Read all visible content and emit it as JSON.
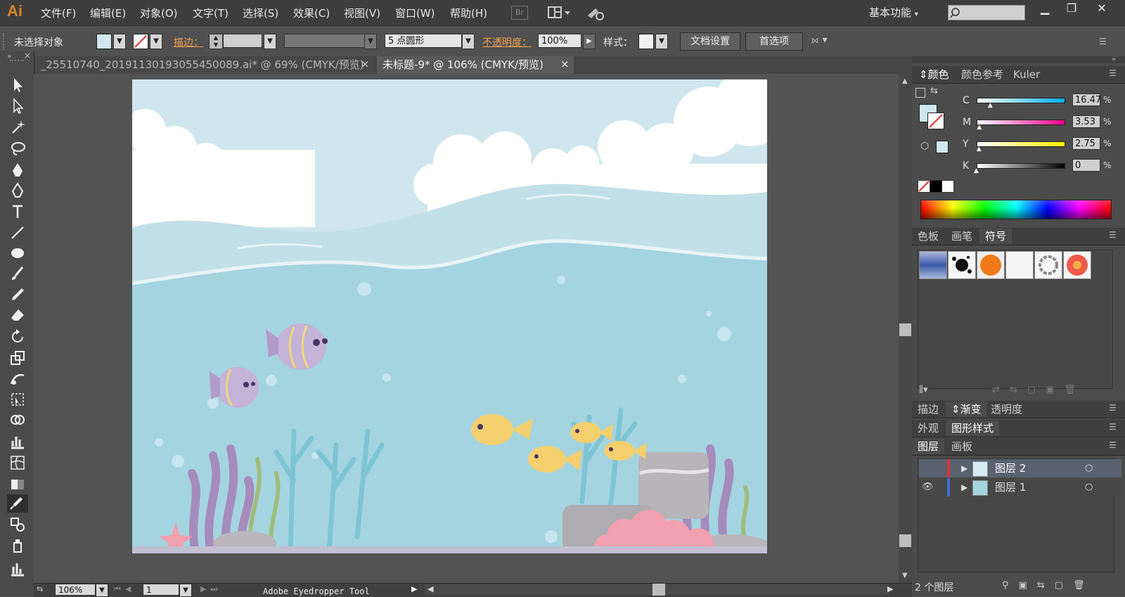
{
  "app": {
    "logo": "Ai"
  },
  "menu": [
    "文件(F)",
    "编辑(E)",
    "对象(O)",
    "文字(T)",
    "选择(S)",
    "效果(C)",
    "视图(V)",
    "窗口(W)",
    "帮助(H)"
  ],
  "toolbar_top": {
    "bridge": "Br",
    "workspace": "基本功能"
  },
  "control": {
    "no_selection": "未选择对象",
    "stroke_label": "描边：",
    "brush": "5 点圆形",
    "opacity_label": "不透明度：",
    "opacity_value": "100%",
    "style_label": "样式：",
    "doc_setup": "文档设置",
    "preferences": "首选项"
  },
  "tabs": [
    {
      "label": "_25510740_20191130193055450089.ai* @ 69% (CMYK/预览)",
      "active": false
    },
    {
      "label": "未标题-9* @ 106% (CMYK/预览)",
      "active": true
    }
  ],
  "tools": [
    "selection-tool",
    "direct-selection-tool",
    "magic-wand-tool",
    "lasso-tool",
    "pen-tool",
    "pen-curvature-tool",
    "type-tool",
    "line-tool",
    "ellipse-tool",
    "paintbrush-tool",
    "pencil-tool",
    "eraser-tool",
    "rotate-tool",
    "scale-tool",
    "warp-tool",
    "free-transform-tool",
    "shape-builder-tool",
    "graph-tool",
    "mesh-tool",
    "gradient-tool",
    "eyedropper-tool",
    "blend-tool",
    "symbol-sprayer-tool",
    "column-graph-tool"
  ],
  "panels": {
    "color_tabs": [
      "颜色",
      "颜色参考",
      "Kuler"
    ],
    "cmyk": [
      {
        "label": "C",
        "value": "16.47",
        "pct": 0.16
      },
      {
        "label": "M",
        "value": "3.53",
        "pct": 0.035
      },
      {
        "label": "Y",
        "value": "2.75",
        "pct": 0.03
      },
      {
        "label": "K",
        "value": "0",
        "pct": 0
      }
    ],
    "percent": "%",
    "swatch_tabs": [
      "色板",
      "画笔",
      "符号"
    ],
    "stroke_tabs": [
      "描边",
      "渐变",
      "透明度"
    ],
    "appearance_tabs": [
      "外观",
      "图形样式"
    ],
    "layers_tabs": [
      "图层",
      "画板"
    ],
    "layers": [
      {
        "name": "图层 2",
        "selected": true
      },
      {
        "name": "图层 1",
        "selected": false
      }
    ],
    "layer_count": "2 个图层"
  },
  "status": {
    "zoom": "106%",
    "artboard": "1",
    "tool": "Adobe Eyedropper Tool"
  },
  "colors": {
    "fill": "#cfe8ef",
    "sea": "#a4d4e0",
    "accent": "#d9852b"
  }
}
